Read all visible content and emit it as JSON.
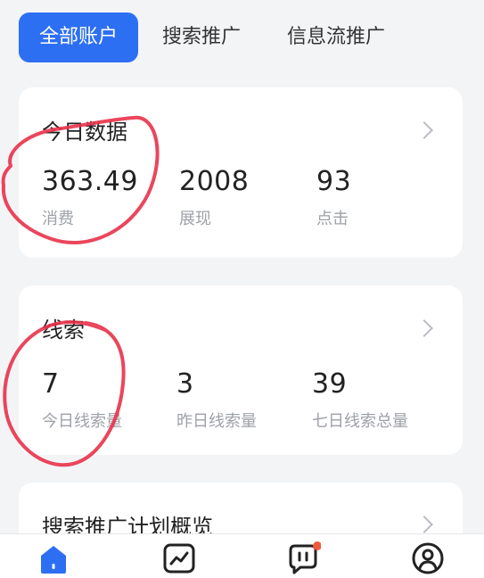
{
  "tabs": [
    {
      "label": "全部账户",
      "active": true
    },
    {
      "label": "搜索推广",
      "active": false
    },
    {
      "label": "信息流推广",
      "active": false
    }
  ],
  "today": {
    "title": "今日数据",
    "metrics": [
      {
        "value": "363.49",
        "label": "消费"
      },
      {
        "value": "2008",
        "label": "展现"
      },
      {
        "value": "93",
        "label": "点击"
      }
    ]
  },
  "leads": {
    "title": "线索",
    "metrics": [
      {
        "value": "7",
        "label": "今日线索量"
      },
      {
        "value": "3",
        "label": "昨日线索量"
      },
      {
        "value": "39",
        "label": "七日线索总量"
      }
    ]
  },
  "plan_overview": {
    "title": "搜索推广计划概览"
  },
  "bottom_nav": {
    "items": [
      {
        "icon": "home-icon",
        "active": true
      },
      {
        "icon": "trend-chart-icon",
        "active": false
      },
      {
        "icon": "message-icon",
        "active": false,
        "badge": true
      },
      {
        "icon": "user-profile-icon",
        "active": false
      }
    ]
  },
  "colors": {
    "accent": "#2d6ff3",
    "badge": "#f05a3c",
    "annotation": "#e8324a"
  }
}
